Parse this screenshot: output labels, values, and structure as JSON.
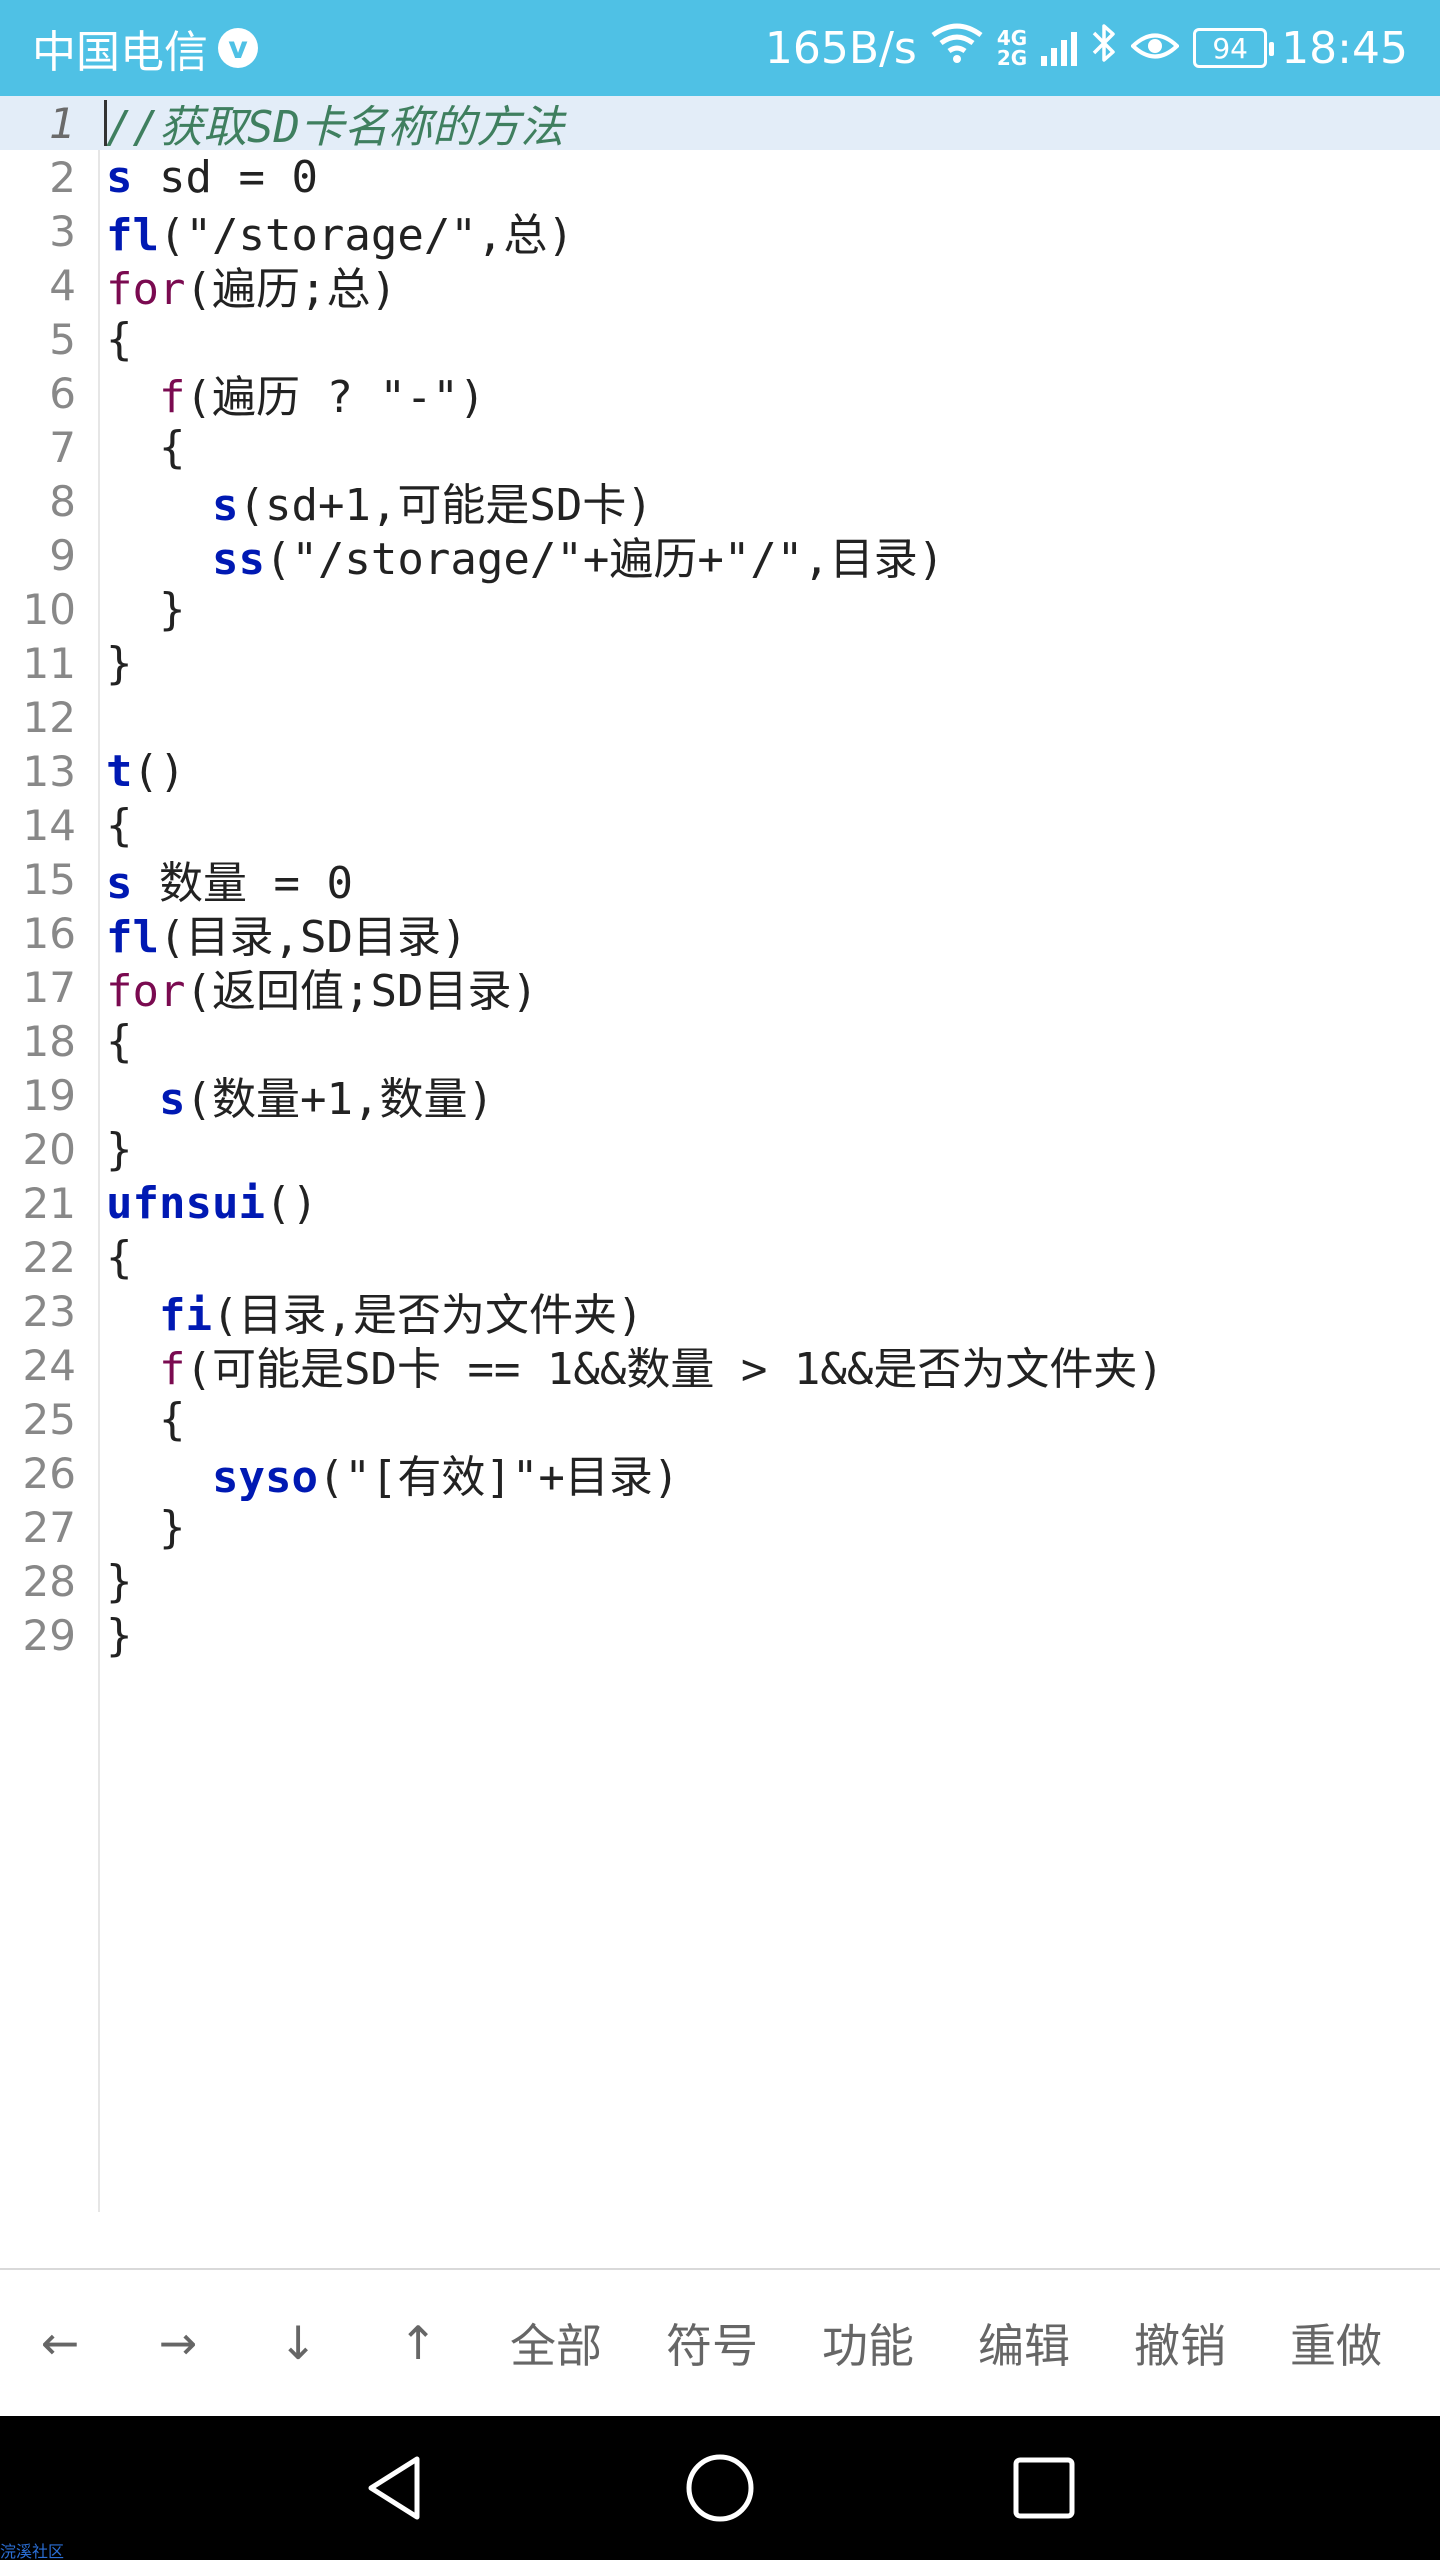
{
  "status_bar": {
    "carrier": "中国电信",
    "verified_glyph": "v",
    "net_speed": "165B/s",
    "network_top": "4G",
    "network_bottom": "2G",
    "battery": "94",
    "time": "18:45"
  },
  "editor": {
    "lines": [
      {
        "n": "1",
        "segments": [
          {
            "t": "//获取SD卡名称的方法",
            "c": "comment"
          }
        ]
      },
      {
        "n": "2",
        "segments": [
          {
            "t": "s",
            "c": "kw-blue"
          },
          {
            "t": " sd = 0",
            "c": ""
          }
        ]
      },
      {
        "n": "3",
        "segments": [
          {
            "t": "fl",
            "c": "kw-blue"
          },
          {
            "t": "(\"/storage/\",总)",
            "c": ""
          }
        ]
      },
      {
        "n": "4",
        "segments": [
          {
            "t": "for",
            "c": "kw-purple"
          },
          {
            "t": "(遍历;总)",
            "c": ""
          }
        ]
      },
      {
        "n": "5",
        "segments": [
          {
            "t": "{",
            "c": ""
          }
        ]
      },
      {
        "n": "6",
        "segments": [
          {
            "t": "  ",
            "c": ""
          },
          {
            "t": "f",
            "c": "kw-purple"
          },
          {
            "t": "(遍历 ? \"-\")",
            "c": ""
          }
        ]
      },
      {
        "n": "7",
        "segments": [
          {
            "t": "  {",
            "c": ""
          }
        ]
      },
      {
        "n": "8",
        "segments": [
          {
            "t": "    ",
            "c": ""
          },
          {
            "t": "s",
            "c": "kw-blue"
          },
          {
            "t": "(sd+1,可能是SD卡)",
            "c": ""
          }
        ]
      },
      {
        "n": "9",
        "segments": [
          {
            "t": "    ",
            "c": ""
          },
          {
            "t": "ss",
            "c": "kw-blue"
          },
          {
            "t": "(\"/storage/\"+遍历+\"/\",目录)",
            "c": ""
          }
        ]
      },
      {
        "n": "10",
        "segments": [
          {
            "t": "  }",
            "c": ""
          }
        ]
      },
      {
        "n": "11",
        "segments": [
          {
            "t": "}",
            "c": ""
          }
        ]
      },
      {
        "n": "12",
        "segments": []
      },
      {
        "n": "13",
        "segments": [
          {
            "t": "t",
            "c": "kw-blue"
          },
          {
            "t": "()",
            "c": ""
          }
        ]
      },
      {
        "n": "14",
        "segments": [
          {
            "t": "{",
            "c": ""
          }
        ]
      },
      {
        "n": "15",
        "segments": [
          {
            "t": "s",
            "c": "kw-blue"
          },
          {
            "t": " 数量 = 0",
            "c": ""
          }
        ]
      },
      {
        "n": "16",
        "segments": [
          {
            "t": "fl",
            "c": "kw-blue"
          },
          {
            "t": "(目录,SD目录)",
            "c": ""
          }
        ]
      },
      {
        "n": "17",
        "segments": [
          {
            "t": "for",
            "c": "kw-purple"
          },
          {
            "t": "(返回值;SD目录)",
            "c": ""
          }
        ]
      },
      {
        "n": "18",
        "segments": [
          {
            "t": "{",
            "c": ""
          }
        ]
      },
      {
        "n": "19",
        "segments": [
          {
            "t": "  ",
            "c": ""
          },
          {
            "t": "s",
            "c": "kw-blue"
          },
          {
            "t": "(数量+1,数量)",
            "c": ""
          }
        ]
      },
      {
        "n": "20",
        "segments": [
          {
            "t": "}",
            "c": ""
          }
        ]
      },
      {
        "n": "21",
        "segments": [
          {
            "t": "ufnsui",
            "c": "kw-blue"
          },
          {
            "t": "()",
            "c": ""
          }
        ]
      },
      {
        "n": "22",
        "segments": [
          {
            "t": "{",
            "c": ""
          }
        ]
      },
      {
        "n": "23",
        "segments": [
          {
            "t": "  ",
            "c": ""
          },
          {
            "t": "fi",
            "c": "kw-blue"
          },
          {
            "t": "(目录,是否为文件夹)",
            "c": ""
          }
        ]
      },
      {
        "n": "24",
        "segments": [
          {
            "t": "  ",
            "c": ""
          },
          {
            "t": "f",
            "c": "kw-purple"
          },
          {
            "t": "(可能是SD卡 == 1&&数量 > 1&&是否为文件夹)",
            "c": ""
          }
        ]
      },
      {
        "n": "25",
        "segments": [
          {
            "t": "  {",
            "c": ""
          }
        ]
      },
      {
        "n": "26",
        "segments": [
          {
            "t": "    ",
            "c": ""
          },
          {
            "t": "syso",
            "c": "kw-blue"
          },
          {
            "t": "(\"[有效]\"+目录)",
            "c": ""
          }
        ]
      },
      {
        "n": "27",
        "segments": [
          {
            "t": "  }",
            "c": ""
          }
        ]
      },
      {
        "n": "28",
        "segments": [
          {
            "t": "}",
            "c": ""
          }
        ]
      },
      {
        "n": "29",
        "segments": [
          {
            "t": "}",
            "c": ""
          }
        ]
      }
    ]
  },
  "toolbar": {
    "left_arrow": "←",
    "right_arrow": "→",
    "down_arrow": "↓",
    "up_arrow": "↑",
    "select_all": "全部",
    "symbols": "符号",
    "functions": "功能",
    "edit": "编辑",
    "undo": "撤销",
    "redo": "重做"
  },
  "watermark": "浣溪社区",
  "colors": {
    "status_bar": "#4fc1e5",
    "keyword_blue": "#0019b3",
    "keyword_purple": "#7a0a50",
    "comment": "#3f7f5f",
    "current_line": "#e3edf8"
  }
}
